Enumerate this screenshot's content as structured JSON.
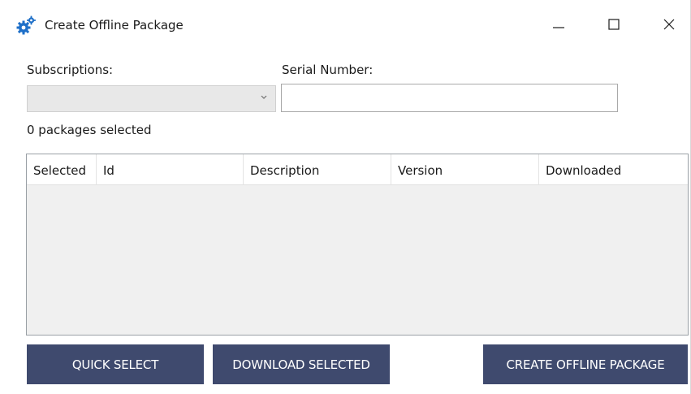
{
  "window": {
    "title": "Create Offline Package",
    "app_icon": "gears-icon",
    "controls": {
      "minimize": "minimize-icon",
      "maximize": "maximize-icon",
      "close": "close-icon"
    }
  },
  "form": {
    "subscriptions_label": "Subscriptions:",
    "subscriptions_value": "",
    "serial_number_label": "Serial Number:",
    "serial_number_value": "",
    "selection_status": "0 packages selected"
  },
  "table": {
    "columns": [
      "Selected",
      "Id",
      "Description",
      "Version",
      "Downloaded"
    ],
    "rows": []
  },
  "buttons": {
    "quick_select": "QUICK SELECT",
    "download_selected": "DOWNLOAD SELECTED",
    "create_offline_package": "CREATE OFFLINE PACKAGE"
  },
  "colors": {
    "button_bg": "#3f4a6e",
    "icon_blue": "#1e6fc8",
    "grid_bg": "#f0f0f0"
  }
}
